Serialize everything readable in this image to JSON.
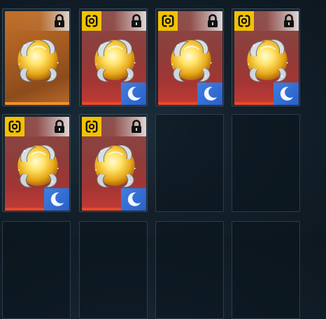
{
  "inventory": {
    "columns": 4,
    "slots": [
      {
        "filled": true,
        "variant": "orange",
        "item": "golden-orb",
        "locked": true,
        "rarity_badge": false,
        "moon_badge": false
      },
      {
        "filled": true,
        "variant": "red",
        "item": "golden-orb",
        "locked": true,
        "rarity_badge": true,
        "moon_badge": true
      },
      {
        "filled": true,
        "variant": "red",
        "item": "golden-orb",
        "locked": true,
        "rarity_badge": true,
        "moon_badge": true
      },
      {
        "filled": true,
        "variant": "red",
        "item": "golden-orb",
        "locked": true,
        "rarity_badge": true,
        "moon_badge": true
      },
      {
        "filled": true,
        "variant": "red",
        "item": "golden-orb",
        "locked": true,
        "rarity_badge": true,
        "moon_badge": true
      },
      {
        "filled": true,
        "variant": "red",
        "item": "golden-orb",
        "locked": true,
        "rarity_badge": true,
        "moon_badge": true
      },
      {
        "filled": false
      },
      {
        "filled": false
      },
      {
        "filled": false
      },
      {
        "filled": false
      },
      {
        "filled": false
      },
      {
        "filled": false
      }
    ]
  },
  "colors": {
    "rarity_yellow": "#f2c200",
    "moon_blue": "#3f7fe0",
    "orange_card": "#b0612a",
    "red_card": "#8e3d3a"
  },
  "icons": {
    "lock": "lock-icon",
    "rarity": "rarity-token-icon",
    "moon": "crescent-moon-icon",
    "item": "golden-orb-icon"
  }
}
